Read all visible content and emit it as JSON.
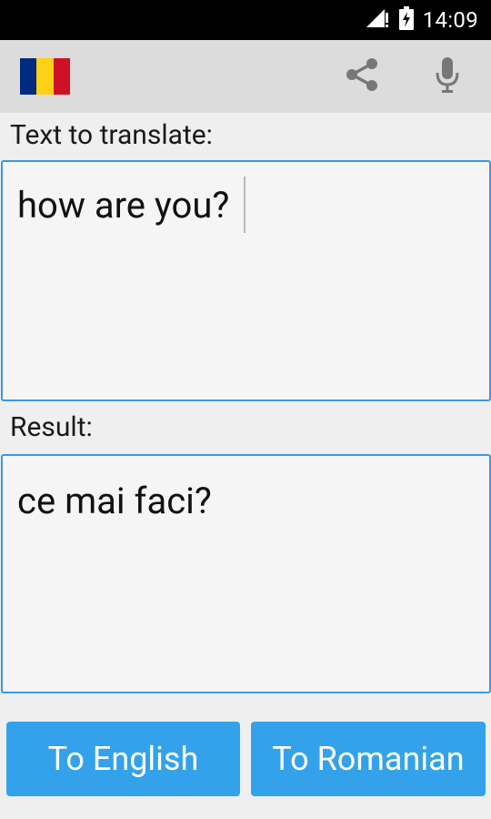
{
  "status_bar": {
    "time": "14:09",
    "icons": [
      "signal-icon",
      "battery-charging-icon"
    ]
  },
  "app_bar": {
    "language_flag": {
      "icon": "romania-flag-icon",
      "colors": [
        "#002B7F",
        "#FCD116",
        "#CE1126"
      ]
    },
    "actions": [
      "share-icon",
      "microphone-icon"
    ]
  },
  "source": {
    "label": "Text to translate:",
    "value": "how are you?"
  },
  "result": {
    "label": "Result:",
    "value": "ce mai faci?"
  },
  "buttons": {
    "to_english": "To English",
    "to_romanian": "To Romanian"
  },
  "colors": {
    "accent": "#33A2EA",
    "field_border": "#3B98E6",
    "app_bar_bg": "#DCDCDC"
  }
}
